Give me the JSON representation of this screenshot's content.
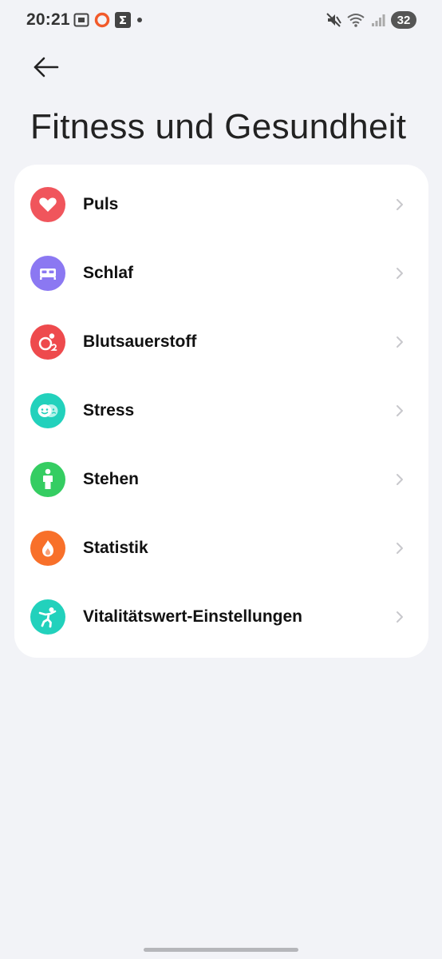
{
  "status_bar": {
    "time": "20:21",
    "battery": "32",
    "left_icons": [
      "screenshot-icon",
      "record-icon",
      "sigma-icon",
      "dot-icon"
    ],
    "right_icons": [
      "mute-icon",
      "wifi-icon",
      "signal-icon"
    ]
  },
  "header": {
    "title": "Fitness und Gesundheit",
    "back_icon": "arrow-left-icon"
  },
  "items": [
    {
      "label": "Puls",
      "icon": "heart-icon",
      "color": "#f0555c"
    },
    {
      "label": "Schlaf",
      "icon": "bed-icon",
      "color": "#8b78f2"
    },
    {
      "label": "Blutsauerstoff",
      "icon": "oxygen-icon",
      "color": "#ee4a4d"
    },
    {
      "label": "Stress",
      "icon": "faces-icon",
      "color": "#22d1bc"
    },
    {
      "label": "Stehen",
      "icon": "standing-person-icon",
      "color": "#35cd62"
    },
    {
      "label": "Statistik",
      "icon": "flame-icon",
      "color": "#f8702a"
    },
    {
      "label": "Vitalitätswert-Einstellungen",
      "icon": "running-person-icon",
      "color": "#22d1bc"
    }
  ],
  "colors": {
    "background": "#f2f3f7",
    "card": "#ffffff",
    "chevron": "#c8c8cc"
  }
}
